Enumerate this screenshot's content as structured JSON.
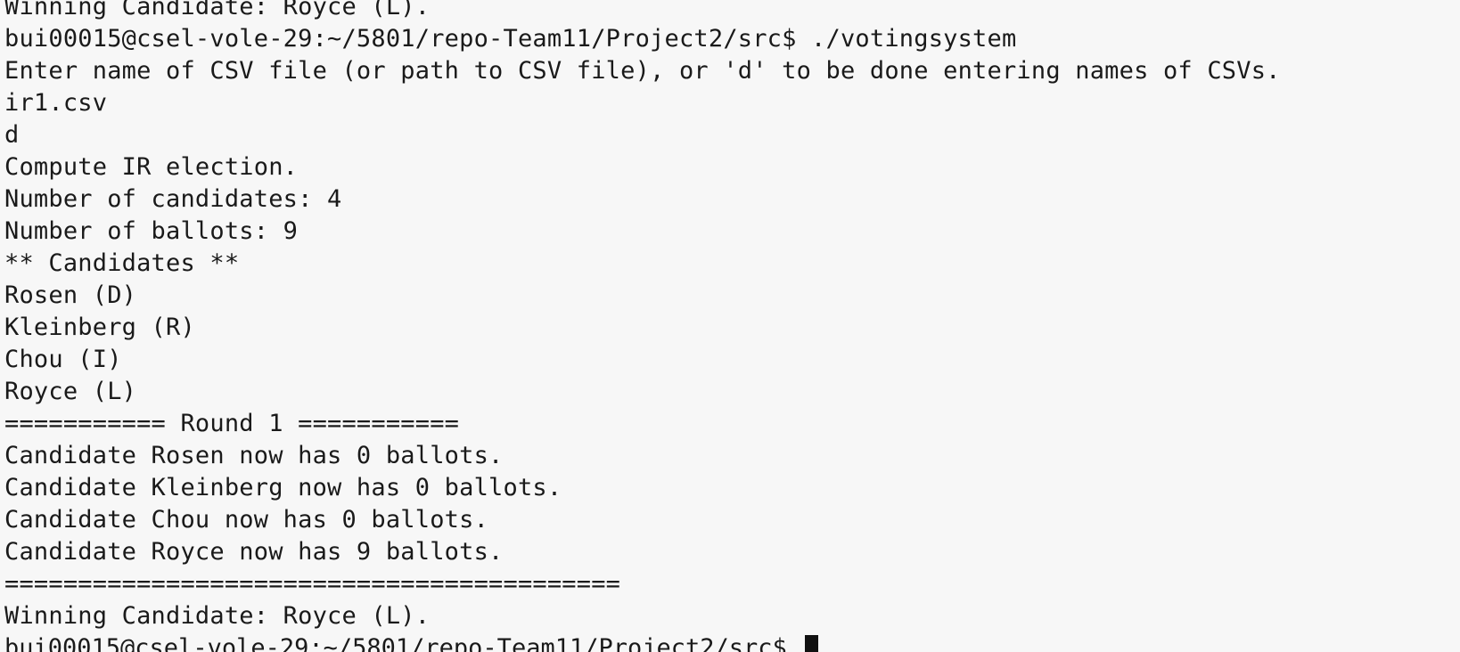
{
  "terminal": {
    "lines": [
      "Winning Candidate: Royce (L).",
      "bui00015@csel-vole-29:~/5801/repo-Team11/Project2/src$ ./votingsystem",
      "Enter name of CSV file (or path to CSV file), or 'd' to be done entering names of CSVs.",
      "ir1.csv",
      "d",
      "Compute IR election.",
      "Number of candidates: 4",
      "Number of ballots: 9",
      "** Candidates **",
      "Rosen (D)",
      "Kleinberg (R)",
      "Chou (I)",
      "Royce (L)",
      "=========== Round 1 ===========",
      "Candidate Rosen now has 0 ballots.",
      "Candidate Kleinberg now has 0 ballots.",
      "Candidate Chou now has 0 ballots.",
      "Candidate Royce now has 9 ballots.",
      "==========================================",
      "Winning Candidate: Royce (L)."
    ],
    "prompt": "bui00015@csel-vole-29:~/5801/repo-Team11/Project2/src$ "
  }
}
